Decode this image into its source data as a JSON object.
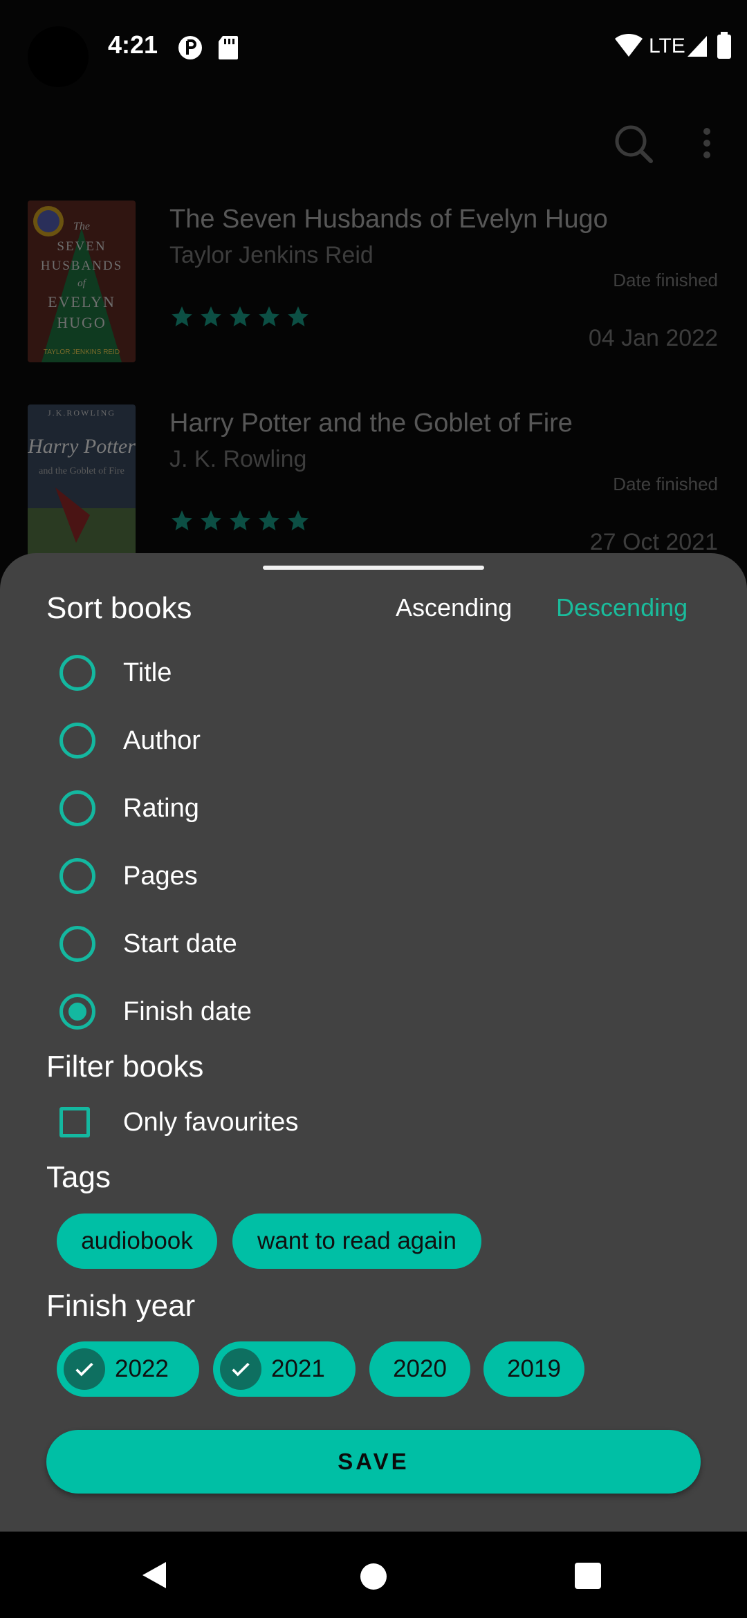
{
  "status_bar": {
    "time": "4:21",
    "network": "LTE"
  },
  "books": [
    {
      "title": "The Seven Husbands of Evelyn Hugo",
      "author": "Taylor Jenkins Reid",
      "date_label": "Date finished",
      "date": "04 Jan 2022",
      "rating": 5,
      "cover": {
        "lines": [
          "The",
          "SEVEN",
          "HUSBANDS",
          "of",
          "EVELYN",
          "HUGO"
        ],
        "author": "TAYLOR JENKINS REID"
      }
    },
    {
      "title": "Harry Potter and the Goblet of Fire",
      "author": "J. K. Rowling",
      "date_label": "Date finished",
      "date": "27 Oct 2021",
      "rating": 5,
      "cover": {
        "top": "J.K.ROWLING",
        "main": "Harry Potter",
        "sub": "and the Goblet of Fire"
      }
    }
  ],
  "sheet": {
    "sort_title": "Sort books",
    "ascending": "Ascending",
    "descending": "Descending",
    "sort_options": [
      "Title",
      "Author",
      "Rating",
      "Pages",
      "Start date",
      "Finish date"
    ],
    "selected_sort": "Finish date",
    "filter_title": "Filter books",
    "only_favourites": "Only favourites",
    "tags_title": "Tags",
    "tags": [
      "audiobook",
      "want to read again"
    ],
    "finish_year_title": "Finish year",
    "years": [
      {
        "label": "2022",
        "selected": true
      },
      {
        "label": "2021",
        "selected": true
      },
      {
        "label": "2020",
        "selected": false
      },
      {
        "label": "2019",
        "selected": false
      }
    ],
    "save": "SAVE"
  },
  "colors": {
    "accent": "#1abc9c",
    "chip": "#00bfa5",
    "sheet": "#424242"
  }
}
